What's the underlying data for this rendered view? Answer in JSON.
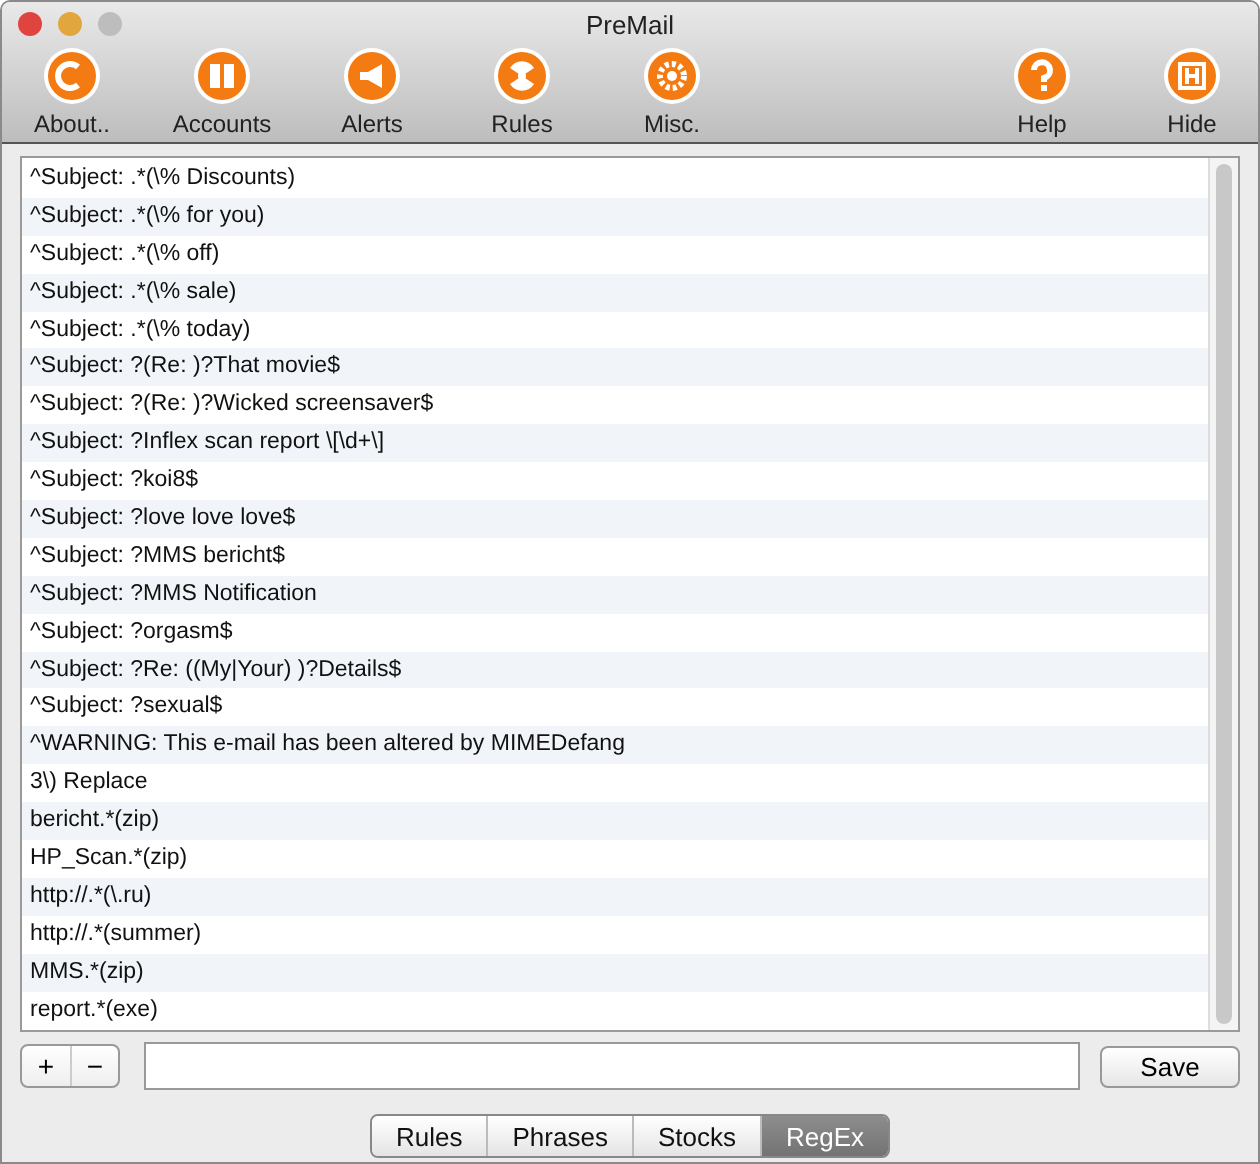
{
  "window": {
    "title": "PreMail"
  },
  "toolbar": {
    "left": [
      {
        "label": "About.."
      },
      {
        "label": "Accounts"
      },
      {
        "label": "Alerts"
      },
      {
        "label": "Rules"
      },
      {
        "label": "Misc."
      }
    ],
    "right": [
      {
        "label": "Help"
      },
      {
        "label": "Hide"
      }
    ]
  },
  "list": {
    "rows": [
      "^Subject: .*(\\% Discounts)",
      "^Subject: .*(\\% for you)",
      "^Subject: .*(\\% off)",
      "^Subject: .*(\\% sale)",
      "^Subject: .*(\\% today)",
      "^Subject: ?(Re: )?That movie$",
      "^Subject: ?(Re: )?Wicked screensaver$",
      "^Subject: ?Inflex scan report \\[\\d+\\]",
      "^Subject: ?koi8$",
      "^Subject: ?love love love$",
      "^Subject: ?MMS bericht$",
      "^Subject: ?MMS Notification",
      "^Subject: ?orgasm$",
      "^Subject: ?Re: ((My|Your) )?Details$",
      "^Subject: ?sexual$",
      "^WARNING: This e-mail has been altered by MIMEDefang",
      "3\\) Replace",
      "bericht.*(zip)",
      "HP_Scan.*(zip)",
      "http://.*(\\.ru)",
      "http://.*(summer)",
      "MMS.*(zip)",
      "report.*(exe)"
    ]
  },
  "controls": {
    "add": "+",
    "remove": "−",
    "save": "Save"
  },
  "tabs": [
    {
      "label": "Rules",
      "selected": false
    },
    {
      "label": "Phrases",
      "selected": false
    },
    {
      "label": "Stocks",
      "selected": false
    },
    {
      "label": "RegEx",
      "selected": true
    }
  ]
}
